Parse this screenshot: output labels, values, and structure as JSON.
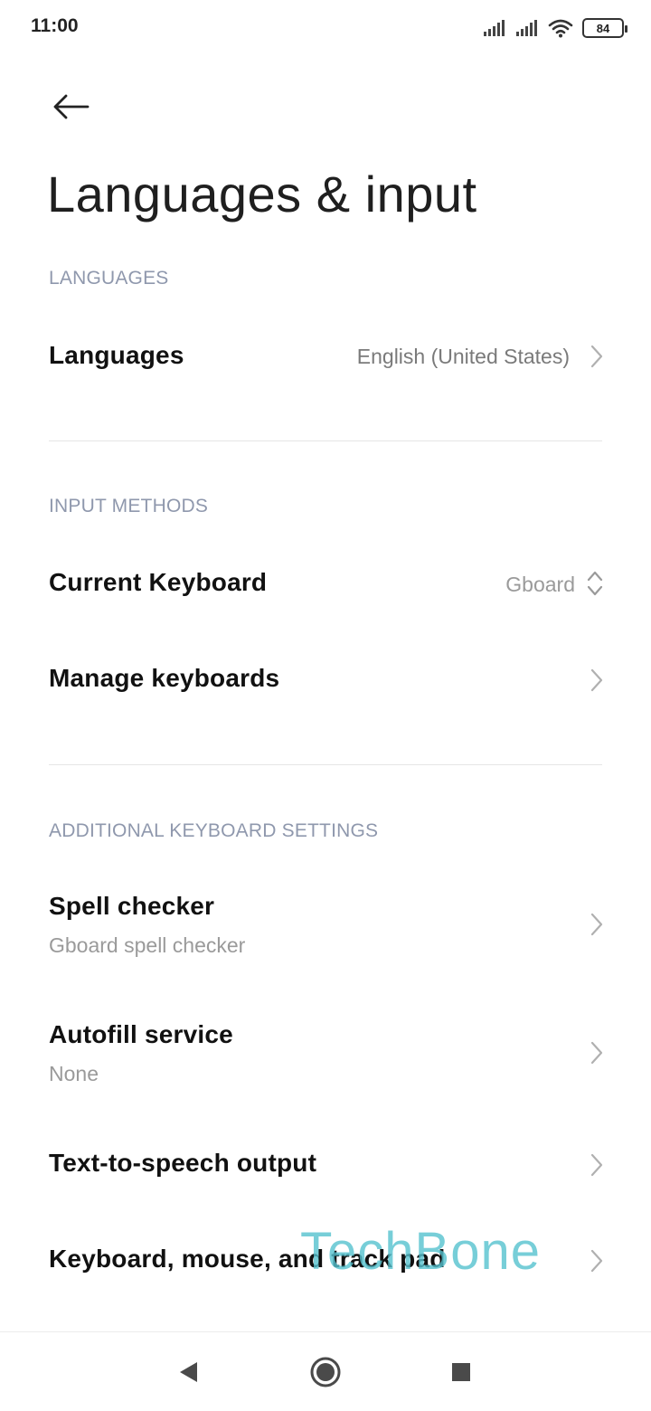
{
  "status_bar": {
    "time": "11:00",
    "battery": "84",
    "icons": [
      "signal-icon",
      "signal-icon",
      "wifi-icon",
      "battery-icon"
    ]
  },
  "header": {
    "back_icon": "arrow-left-icon",
    "title": "Languages & input"
  },
  "sections": {
    "languages": {
      "header": "LANGUAGES",
      "items": [
        {
          "title": "Languages",
          "value": "English (United States)",
          "icon": "chevron-right-icon"
        }
      ]
    },
    "input_methods": {
      "header": "INPUT METHODS",
      "items": [
        {
          "title": "Current Keyboard",
          "value": "Gboard",
          "icon": "chevron-up-down-icon"
        },
        {
          "title": "Manage keyboards",
          "icon": "chevron-right-icon"
        }
      ]
    },
    "additional": {
      "header": "ADDITIONAL KEYBOARD SETTINGS",
      "items": [
        {
          "title": "Spell checker",
          "subtitle": "Gboard spell checker",
          "icon": "chevron-right-icon"
        },
        {
          "title": "Autofill service",
          "subtitle": "None",
          "icon": "chevron-right-icon"
        },
        {
          "title": "Text-to-speech output",
          "icon": "chevron-right-icon"
        },
        {
          "title": "Keyboard, mouse, and track pad",
          "icon": "chevron-right-icon"
        }
      ]
    }
  },
  "watermark": "TechBone",
  "nav_bar": {
    "icons": [
      "back-triangle-icon",
      "home-circle-icon",
      "recents-square-icon"
    ]
  },
  "colors": {
    "section_header": "#8f98ad",
    "title": "#111111",
    "subtitle": "#9a9a9a",
    "watermark": "#56c2cf"
  }
}
